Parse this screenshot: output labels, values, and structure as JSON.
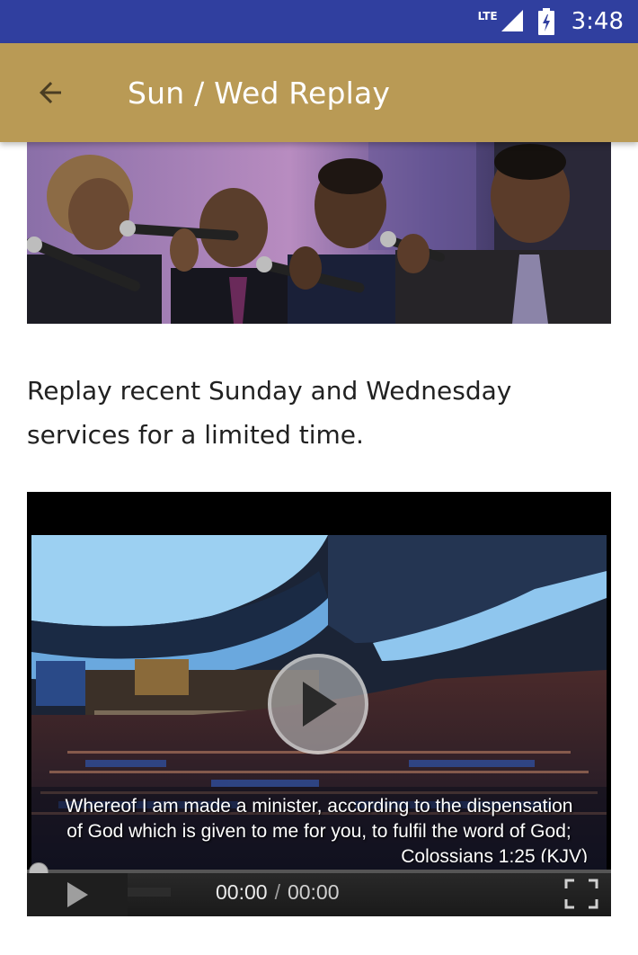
{
  "status_bar": {
    "network": "LTE",
    "time": "3:48",
    "icons": [
      "signal-icon",
      "battery-icon"
    ]
  },
  "app_bar": {
    "title": "Sun / Wed Replay",
    "back_icon": "arrow-back-icon",
    "color": "#b99a55"
  },
  "colors": {
    "status_bar": "#303f9f",
    "app_bar": "#b99a55"
  },
  "banner": {
    "image": "choir-singers-photo"
  },
  "description": "Replay recent Sunday and Wednesday services for a limited time.",
  "video": {
    "thumbnail": "church-sanctuary-congregation",
    "subtitle_line1": "Whereof I am made a minister, according to the dispensation",
    "subtitle_line2": "of God which is given to me for you, to fulfil the word of God;",
    "subtitle_ref": "Colossians 1:25 (KJV)",
    "current_time": "00:00",
    "separator": "/",
    "duration": "00:00",
    "progress": 0
  }
}
